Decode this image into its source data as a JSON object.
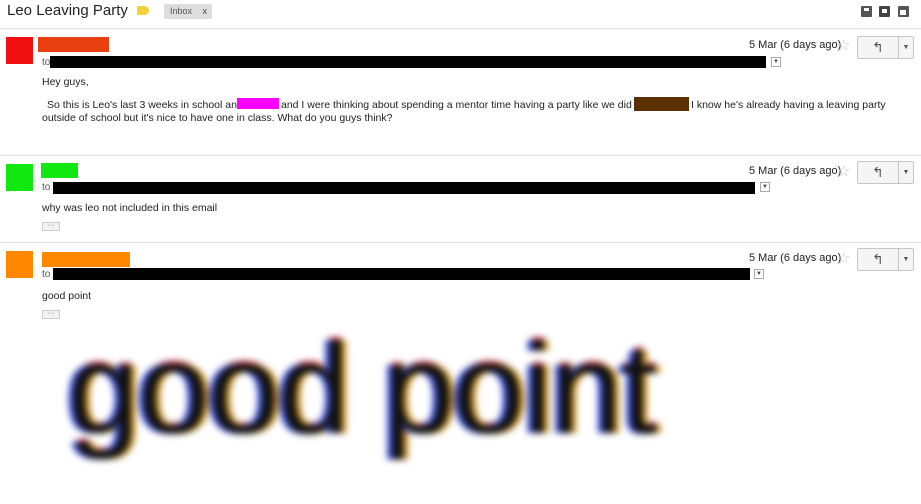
{
  "thread": {
    "subject": "Leo Leaving Party",
    "label_chip": "Inbox",
    "label_chip_close": "x"
  },
  "icons": {
    "label": "label-tag-icon",
    "header_actions": [
      "download-icon",
      "print-icon",
      "new-window-icon"
    ],
    "star": "☆",
    "reply": "↰",
    "more": "▼",
    "dropdown": "▼"
  },
  "messages": [
    {
      "avatar_color": "#f01010",
      "sender_color": "#e84010",
      "date": "5 Mar (6 days ago)",
      "to_label": "to",
      "body_lines": [
        "Hey guys,",
        "So this is Leo's last 3 weeks in school and",
        "and I were thinking about spending a mentor time having a party like we did for",
        "I know he's already having a leaving party",
        "outside of school but it's nice to have one in class. What do you guys think?"
      ],
      "redaction_colors": [
        "#ff00ff",
        "#5a3000"
      ]
    },
    {
      "avatar_color": "#10e810",
      "sender_color": "#10e810",
      "date": "5 Mar (6 days ago)",
      "to_label": "to",
      "body_lines": [
        "why was leo not included in this email"
      ],
      "ellipsis": "···"
    },
    {
      "avatar_color": "#ff8800",
      "sender_color": "#ff8800",
      "date": "5 Mar (6 days ago)",
      "to_label": "to",
      "body_lines": [
        "good point"
      ],
      "ellipsis": "···"
    }
  ],
  "caption": "good point"
}
